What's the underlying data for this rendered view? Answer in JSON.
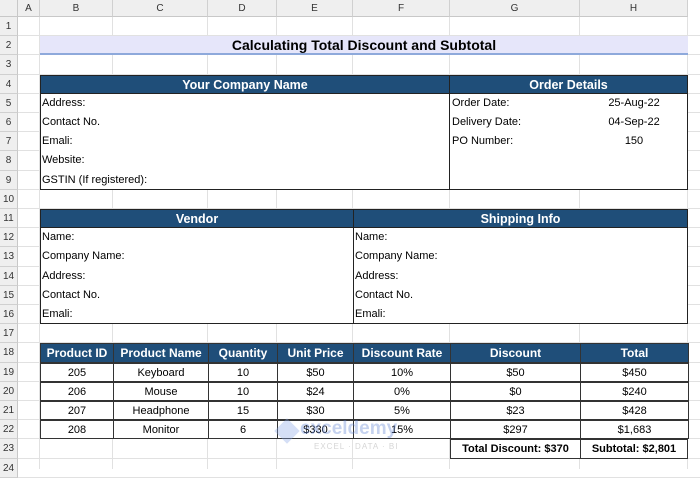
{
  "sheet": {
    "columns": [
      "A",
      "B",
      "C",
      "D",
      "E",
      "F",
      "G",
      "H"
    ],
    "rows": [
      "1",
      "2",
      "3",
      "4",
      "5",
      "6",
      "7",
      "8",
      "9",
      "10",
      "11",
      "12",
      "13",
      "14",
      "15",
      "16",
      "17",
      "18",
      "19",
      "20",
      "21",
      "22",
      "23",
      "24"
    ]
  },
  "title": "Calculating Total Discount and Subtotal",
  "company": {
    "header": "Your Company Name",
    "fields": [
      "Address:",
      "Contact No.",
      "Emali:",
      "Website:",
      "GSTIN (If registered):"
    ]
  },
  "order": {
    "header": "Order Details",
    "fields": [
      {
        "label": "Order Date:",
        "value": "25-Aug-22"
      },
      {
        "label": "Delivery Date:",
        "value": "04-Sep-22"
      },
      {
        "label": "PO Number:",
        "value": "150"
      }
    ]
  },
  "vendor": {
    "header": "Vendor",
    "fields": [
      "Name:",
      "Company Name:",
      "Address:",
      "Contact No.",
      "Emali:"
    ]
  },
  "shipping": {
    "header": "Shipping Info",
    "fields": [
      "Name:",
      "Company Name:",
      "Address:",
      "Contact No.",
      "Emali:"
    ]
  },
  "products": {
    "headers": [
      "Product ID",
      "Product Name",
      "Quantity",
      "Unit Price",
      "Discount Rate",
      "Discount",
      "Total"
    ],
    "rows": [
      [
        "205",
        "Keyboard",
        "10",
        "$50",
        "10%",
        "$50",
        "$450"
      ],
      [
        "206",
        "Mouse",
        "10",
        "$24",
        "0%",
        "$0",
        "$240"
      ],
      [
        "207",
        "Headphone",
        "15",
        "$30",
        "5%",
        "$23",
        "$428"
      ],
      [
        "208",
        "Monitor",
        "6",
        "$330",
        "15%",
        "$297",
        "$1,683"
      ]
    ],
    "total_discount": "Total Discount: $370",
    "subtotal": "Subtotal: $2,801"
  },
  "watermark": {
    "brand": "exceldemy",
    "tagline": "EXCEL · DATA · BI"
  },
  "colors": {
    "header_bg": "#1f4e79",
    "title_bg": "#e6e6fa",
    "title_underline": "#8ea9db"
  }
}
